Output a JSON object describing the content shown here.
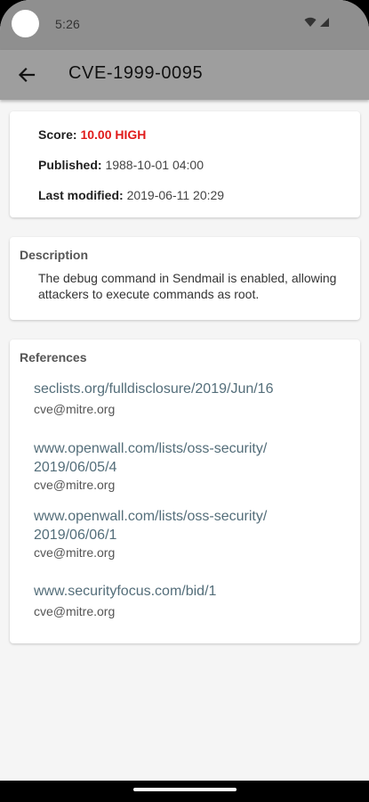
{
  "status_bar": {
    "time": "5:26",
    "icons": [
      "wifi-icon",
      "signal-icon"
    ]
  },
  "app_bar": {
    "back_icon": "arrow-left-icon",
    "title": "CVE-1999-0095"
  },
  "summary": {
    "score_label": "Score:",
    "score_value": "10.00 HIGH",
    "score_color": "#e01b1b",
    "published_label": "Published:",
    "published_value": "1988-10-01 04:00",
    "modified_label": "Last modified:",
    "modified_value": "2019-06-11 20:29"
  },
  "description": {
    "heading": "Description",
    "text": "The debug command in Sendmail is enabled, allowing attackers to execute commands as root."
  },
  "references": {
    "heading": "References",
    "items": [
      {
        "line1": "seclists.org/fulldisclosure/2019/Jun/16",
        "line2": "",
        "source": "cve@mitre.org"
      },
      {
        "line1": "www.openwall.com/lists/oss-security/",
        "line2": "2019/06/05/4",
        "source": "cve@mitre.org"
      },
      {
        "line1": "www.openwall.com/lists/oss-security/",
        "line2": "2019/06/06/1",
        "source": "cve@mitre.org"
      },
      {
        "line1": "www.securityfocus.com/bid/1",
        "line2": "",
        "source": "cve@mitre.org"
      }
    ]
  },
  "colors": {
    "status_bar": "#8f8f8f",
    "app_bar": "#9e9e9e",
    "link": "#546e7a",
    "background": "#f5f5f5"
  }
}
